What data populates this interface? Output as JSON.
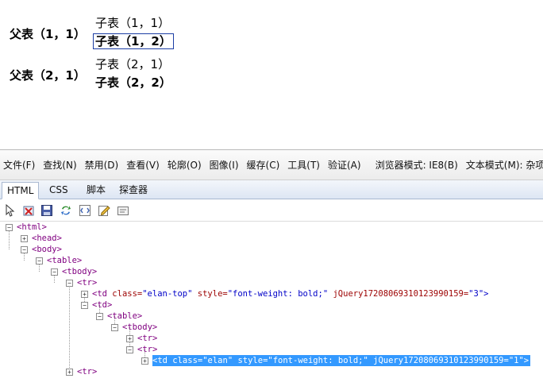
{
  "page": {
    "parent1": "父表（1，1）",
    "child11": "子表（1，1）",
    "child12": "子表（1，2）",
    "parent2": "父表（2，1）",
    "child21": "子表（2，1）",
    "child22": "子表（2，2）"
  },
  "devtools": {
    "menu": [
      "文件(F)",
      "查找(N)",
      "禁用(D)",
      "查看(V)",
      "轮廓(O)",
      "图像(I)",
      "缓存(C)",
      "工具(T)",
      "验证(A)"
    ],
    "browser_mode": "浏览器模式: IE8(B)",
    "doc_mode": "文本模式(M): 杂项",
    "tabs": [
      "HTML",
      "CSS",
      "脚本",
      "探查器"
    ],
    "tree": {
      "html": "<html>",
      "head": "<head>",
      "body": "<body>",
      "table": "<table>",
      "tbody": "<tbody>",
      "tr": "<tr>",
      "td1_open": "<td",
      "td1_class_attr": "class=",
      "td1_class_val": "\"elan-top\"",
      "td1_style_attr": "style=",
      "td1_style_val": "\"font-weight: bold;\"",
      "td1_jq_attr": "jQuery17208069310123990159=",
      "td1_jq_val": "\"3\">",
      "td": "<td>",
      "inner_table": "<table>",
      "inner_tbody": "<tbody>",
      "inner_tr1": "<tr>",
      "inner_tr2": "<tr>",
      "sel_line": "<td class=\"elan\" style=\"font-weight: bold;\" jQuery17208069310123990159=\"1\">",
      "last_tr": "<tr>"
    }
  },
  "colors": {
    "selection": "#3399ff",
    "tag": "#800080",
    "attr": "#9c0000",
    "value": "#0000c8"
  }
}
